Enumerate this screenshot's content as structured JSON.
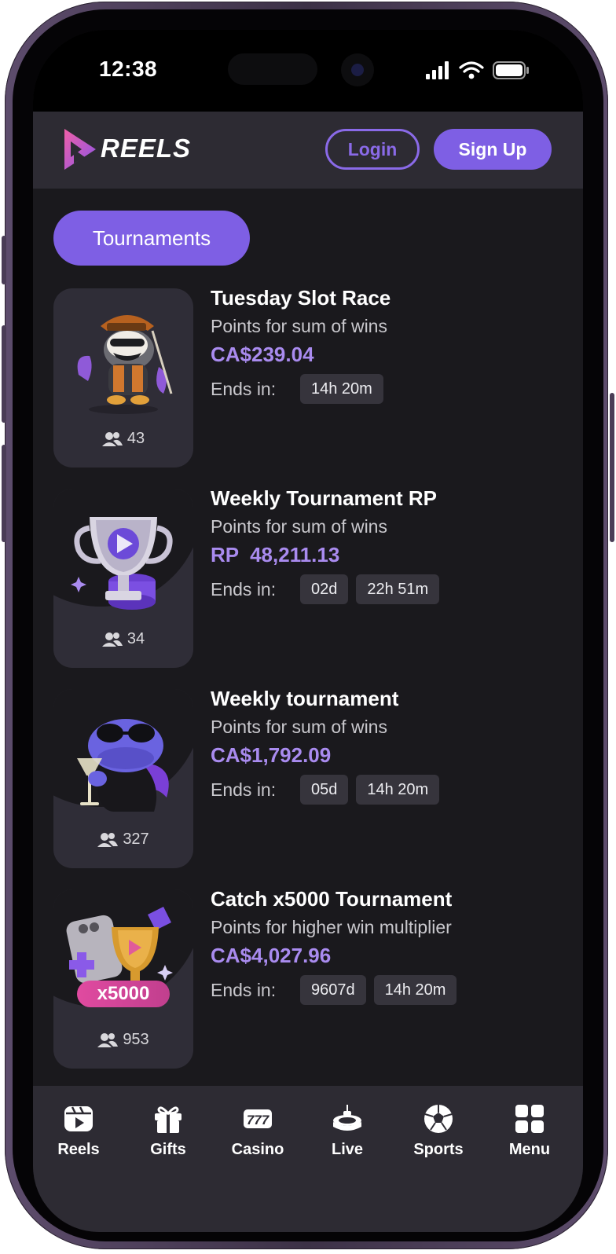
{
  "status_bar": {
    "time": "12:38"
  },
  "header": {
    "brand": "REELS",
    "login_label": "Login",
    "signup_label": "Sign Up"
  },
  "section": {
    "title": "Tournaments"
  },
  "tournaments": [
    {
      "title": "Tuesday Slot Race",
      "subtitle": "Points for sum of wins",
      "prize": "CA$239.04",
      "ends_label": "Ends in:",
      "chips": [
        "14h 20m"
      ],
      "players": "43"
    },
    {
      "title": "Weekly Tournament RP",
      "subtitle": "Points for sum of wins",
      "prize": "RP  48,211.13",
      "ends_label": "Ends in:",
      "chips": [
        "02d",
        "22h 51m"
      ],
      "players": "34"
    },
    {
      "title": "Weekly tournament",
      "subtitle": "Points for sum of wins",
      "prize": "CA$1,792.09",
      "ends_label": "Ends in:",
      "chips": [
        "05d",
        "14h 20m"
      ],
      "players": "327"
    },
    {
      "title": "Catch x5000 Tournament",
      "subtitle": "Points for higher win multiplier",
      "prize": "CA$4,027.96",
      "ends_label": "Ends in:",
      "chips": [
        "9607d",
        "14h 20m"
      ],
      "players": "953",
      "badge": "x5000"
    }
  ],
  "nav": {
    "items": [
      {
        "label": "Reels",
        "icon": "reels-icon"
      },
      {
        "label": "Gifts",
        "icon": "gift-icon"
      },
      {
        "label": "Casino",
        "icon": "slot-777-icon"
      },
      {
        "label": "Live",
        "icon": "roulette-icon"
      },
      {
        "label": "Sports",
        "icon": "soccer-ball-icon"
      },
      {
        "label": "Menu",
        "icon": "grid-menu-icon"
      }
    ]
  },
  "colors": {
    "accent": "#7e5fe4",
    "prize": "#a98bef",
    "background": "#1a191d",
    "surface": "#2d2b33"
  }
}
